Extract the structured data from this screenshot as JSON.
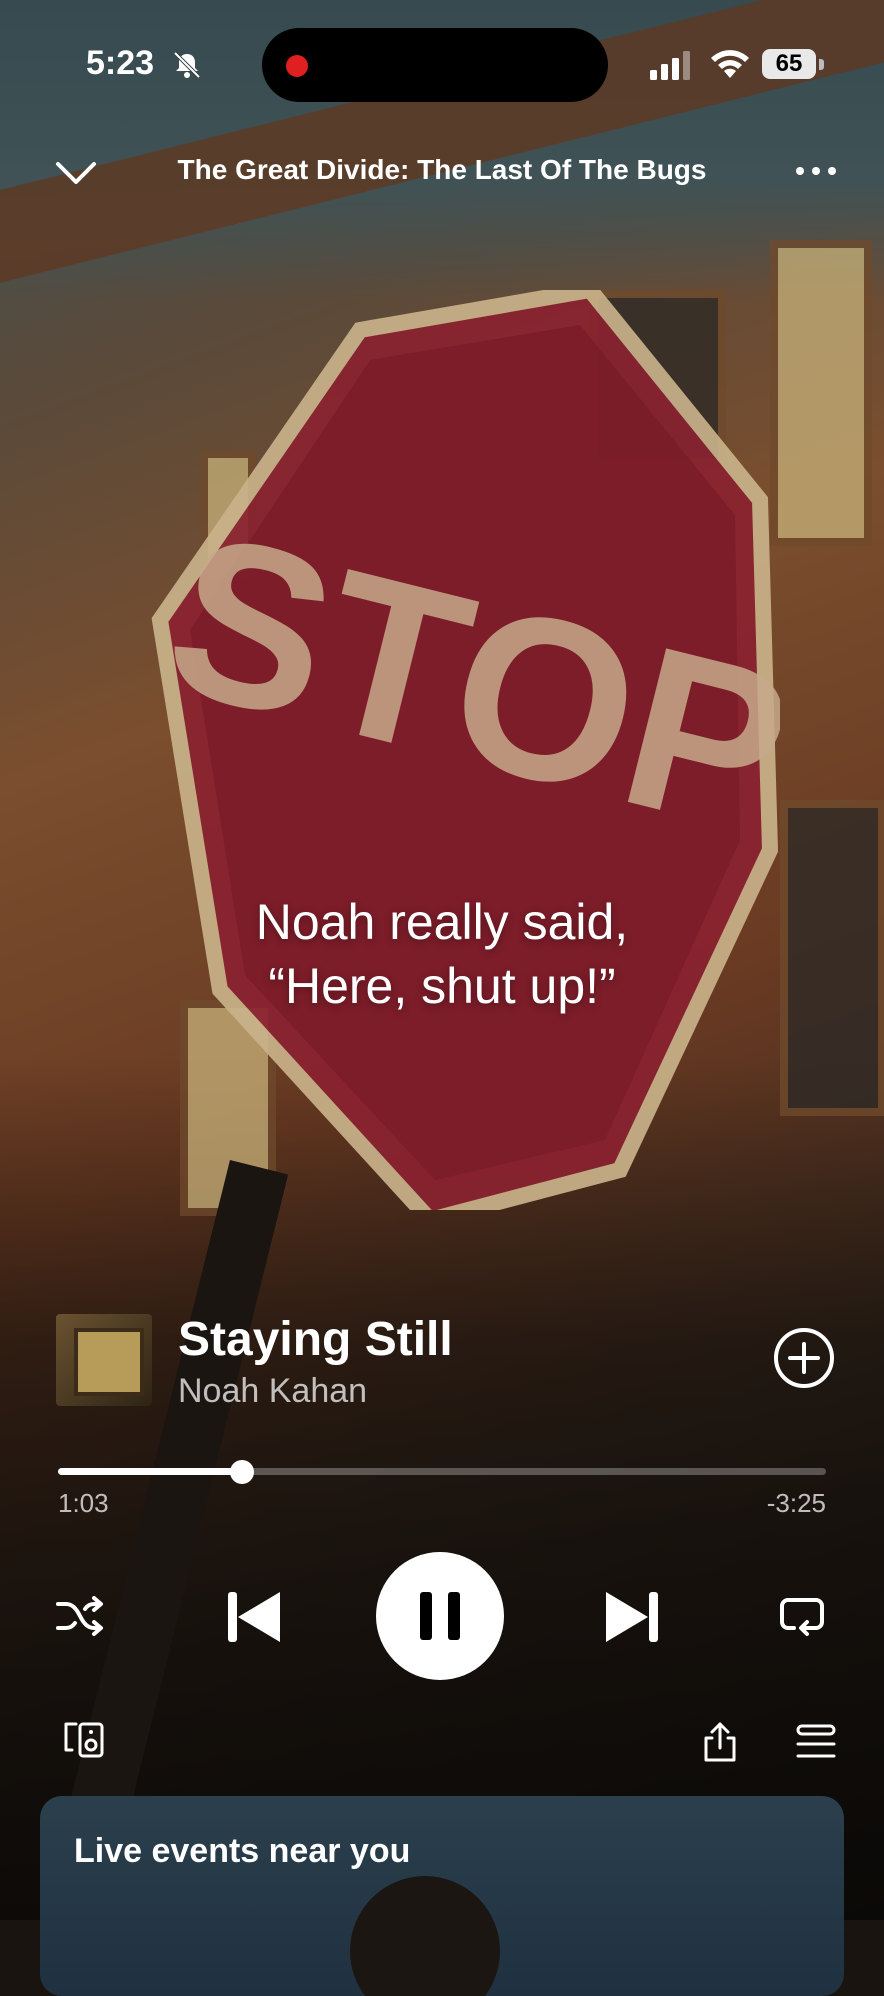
{
  "status_bar": {
    "time": "5:23",
    "battery": "65"
  },
  "header": {
    "playlist_title": "The Great Divide: The Last Of The Bugs"
  },
  "album_art": {
    "sign_text": "STOP"
  },
  "caption": {
    "line1": "Noah really said,",
    "line2": "“Here, shut up!”"
  },
  "track": {
    "title": "Staying Still",
    "artist": "Noah Kahan"
  },
  "playback": {
    "elapsed": "1:03",
    "remaining": "-3:25",
    "progress_fraction": 0.24,
    "state": "playing"
  },
  "events_card": {
    "title": "Live events near you"
  },
  "icons": [
    "bell-off-icon",
    "signal-icon",
    "wifi-icon",
    "battery-icon",
    "chevron-down-icon",
    "more-icon",
    "add-circle-icon",
    "shuffle-icon",
    "previous-icon",
    "pause-icon",
    "next-icon",
    "repeat-icon",
    "devices-icon",
    "share-icon",
    "queue-icon"
  ]
}
